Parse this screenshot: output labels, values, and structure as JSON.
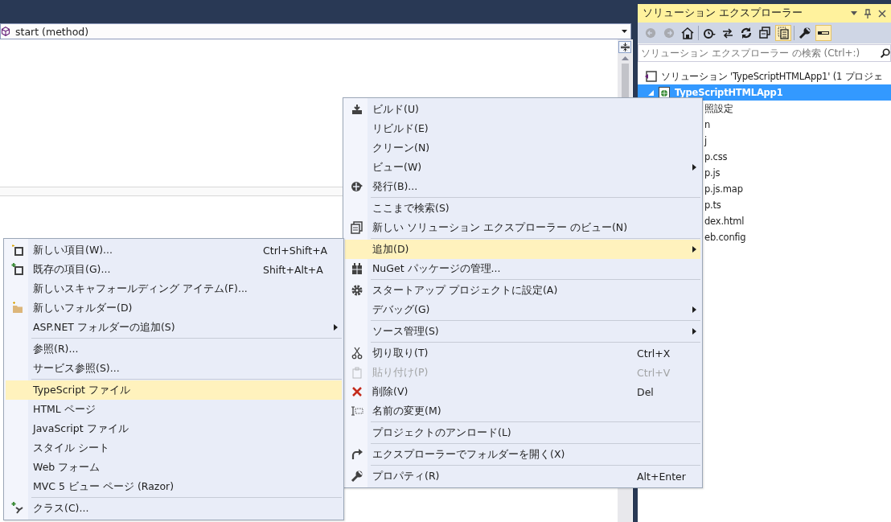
{
  "navigation_bar": {
    "member": "start (method)"
  },
  "solution_explorer": {
    "title": "ソリューション エクスプローラー",
    "toolbar": [
      {
        "disabled": true,
        "on": false
      },
      {
        "disabled": true,
        "on": false
      },
      {
        "disabled": false,
        "on": false
      },
      {
        "disabled": false,
        "on": false
      },
      {
        "disabled": false,
        "on": false
      },
      {
        "disabled": false,
        "on": false
      },
      {
        "disabled": false,
        "on": false
      },
      {
        "disabled": false,
        "on": true
      },
      {
        "disabled": false,
        "on": false
      },
      {
        "disabled": false,
        "on": true
      }
    ],
    "search": {
      "placeholder": "ソリューション エクスプローラー の検索 (Ctrl+:)"
    },
    "tree": [
      {
        "label": "ソリューション 'TypeScriptHTMLApp1' (1 プロジェ",
        "selected": false,
        "children": [
          {
            "label": "TypeScriptHTMLApp1",
            "selected": true,
            "expanded": true,
            "children": [
              {
                "label": "照設定",
                "selected": false
              },
              {
                "label": "n",
                "selected": false
              },
              {
                "label": "j",
                "selected": false
              },
              {
                "label": "p.css",
                "selected": false
              },
              {
                "label": "p.js",
                "selected": false
              },
              {
                "label": "p.js.map",
                "selected": false
              },
              {
                "label": "p.ts",
                "selected": false
              },
              {
                "label": "dex.html",
                "selected": false
              },
              {
                "label": "eb.config",
                "selected": false
              }
            ]
          }
        ]
      }
    ]
  },
  "context_menu": [
    {
      "kind": "item",
      "label": "ビルド(U)",
      "selected": false,
      "disabled": false,
      "submenu": false
    },
    {
      "kind": "item",
      "label": "リビルド(E)",
      "selected": false,
      "disabled": false,
      "submenu": false
    },
    {
      "kind": "item",
      "label": "クリーン(N)",
      "selected": false,
      "disabled": false,
      "submenu": false
    },
    {
      "kind": "item",
      "label": "ビュー(W)",
      "selected": false,
      "disabled": false,
      "submenu": true
    },
    {
      "kind": "item",
      "label": "発行(B)...",
      "selected": false,
      "disabled": false,
      "submenu": false
    },
    {
      "kind": "separator"
    },
    {
      "kind": "item",
      "label": "ここまで検索(S)",
      "selected": false,
      "disabled": false,
      "submenu": false
    },
    {
      "kind": "item",
      "label": "新しい ソリューション エクスプローラー のビュー(N)",
      "selected": false,
      "disabled": false,
      "submenu": false
    },
    {
      "kind": "separator"
    },
    {
      "kind": "item",
      "label": "追加(D)",
      "selected": true,
      "disabled": false,
      "submenu": true
    },
    {
      "kind": "item",
      "label": "NuGet パッケージの管理...",
      "selected": false,
      "disabled": false,
      "submenu": false
    },
    {
      "kind": "separator"
    },
    {
      "kind": "item",
      "label": "スタートアップ プロジェクトに設定(A)",
      "selected": false,
      "disabled": false,
      "submenu": false
    },
    {
      "kind": "item",
      "label": "デバッグ(G)",
      "selected": false,
      "disabled": false,
      "submenu": true
    },
    {
      "kind": "separator"
    },
    {
      "kind": "item",
      "label": "ソース管理(S)",
      "selected": false,
      "disabled": false,
      "submenu": true
    },
    {
      "kind": "separator"
    },
    {
      "kind": "item",
      "label": "切り取り(T)",
      "shortcut": "Ctrl+X",
      "selected": false,
      "disabled": false,
      "submenu": false
    },
    {
      "kind": "item",
      "label": "貼り付け(P)",
      "shortcut": "Ctrl+V",
      "selected": false,
      "disabled": true,
      "submenu": false
    },
    {
      "kind": "item",
      "label": "削除(V)",
      "shortcut": "Del",
      "selected": false,
      "disabled": false,
      "submenu": false
    },
    {
      "kind": "item",
      "label": "名前の変更(M)",
      "selected": false,
      "disabled": false,
      "submenu": false
    },
    {
      "kind": "separator"
    },
    {
      "kind": "item",
      "label": "プロジェクトのアンロード(L)",
      "selected": false,
      "disabled": false,
      "submenu": false
    },
    {
      "kind": "separator"
    },
    {
      "kind": "item",
      "label": "エクスプローラーでフォルダーを開く(X)",
      "selected": false,
      "disabled": false,
      "submenu": false
    },
    {
      "kind": "separator"
    },
    {
      "kind": "item",
      "label": "プロパティ(R)",
      "shortcut": "Alt+Enter",
      "selected": false,
      "disabled": false,
      "submenu": false
    }
  ],
  "add_submenu": [
    {
      "kind": "item",
      "label": "新しい項目(W)...",
      "shortcut": "Ctrl+Shift+A",
      "selected": false,
      "disabled": false,
      "submenu": false
    },
    {
      "kind": "item",
      "label": "既存の項目(G)...",
      "shortcut": "Shift+Alt+A",
      "selected": false,
      "disabled": false,
      "submenu": false
    },
    {
      "kind": "item",
      "label": "新しいスキャフォールディング アイテム(F)...",
      "selected": false,
      "disabled": false,
      "submenu": false
    },
    {
      "kind": "item",
      "label": "新しいフォルダー(D)",
      "selected": false,
      "disabled": false,
      "submenu": false
    },
    {
      "kind": "item",
      "label": "ASP.NET フォルダーの追加(S)",
      "selected": false,
      "disabled": false,
      "submenu": true
    },
    {
      "kind": "separator"
    },
    {
      "kind": "item",
      "label": "参照(R)...",
      "selected": false,
      "disabled": false,
      "submenu": false
    },
    {
      "kind": "item",
      "label": "サービス参照(S)...",
      "selected": false,
      "disabled": false,
      "submenu": false
    },
    {
      "kind": "separator"
    },
    {
      "kind": "item",
      "label": "TypeScript ファイル",
      "selected": true,
      "disabled": false,
      "submenu": false
    },
    {
      "kind": "item",
      "label": "HTML ページ",
      "selected": false,
      "disabled": false,
      "submenu": false
    },
    {
      "kind": "item",
      "label": "JavaScript ファイル",
      "selected": false,
      "disabled": false,
      "submenu": false
    },
    {
      "kind": "item",
      "label": "スタイル シート",
      "selected": false,
      "disabled": false,
      "submenu": false
    },
    {
      "kind": "item",
      "label": "Web フォーム",
      "selected": false,
      "disabled": false,
      "submenu": false
    },
    {
      "kind": "item",
      "label": "MVC 5 ビュー ページ (Razor)",
      "selected": false,
      "disabled": false,
      "submenu": false
    },
    {
      "kind": "separator"
    },
    {
      "kind": "item",
      "label": "クラス(C)...",
      "selected": false,
      "disabled": false,
      "submenu": false
    }
  ]
}
